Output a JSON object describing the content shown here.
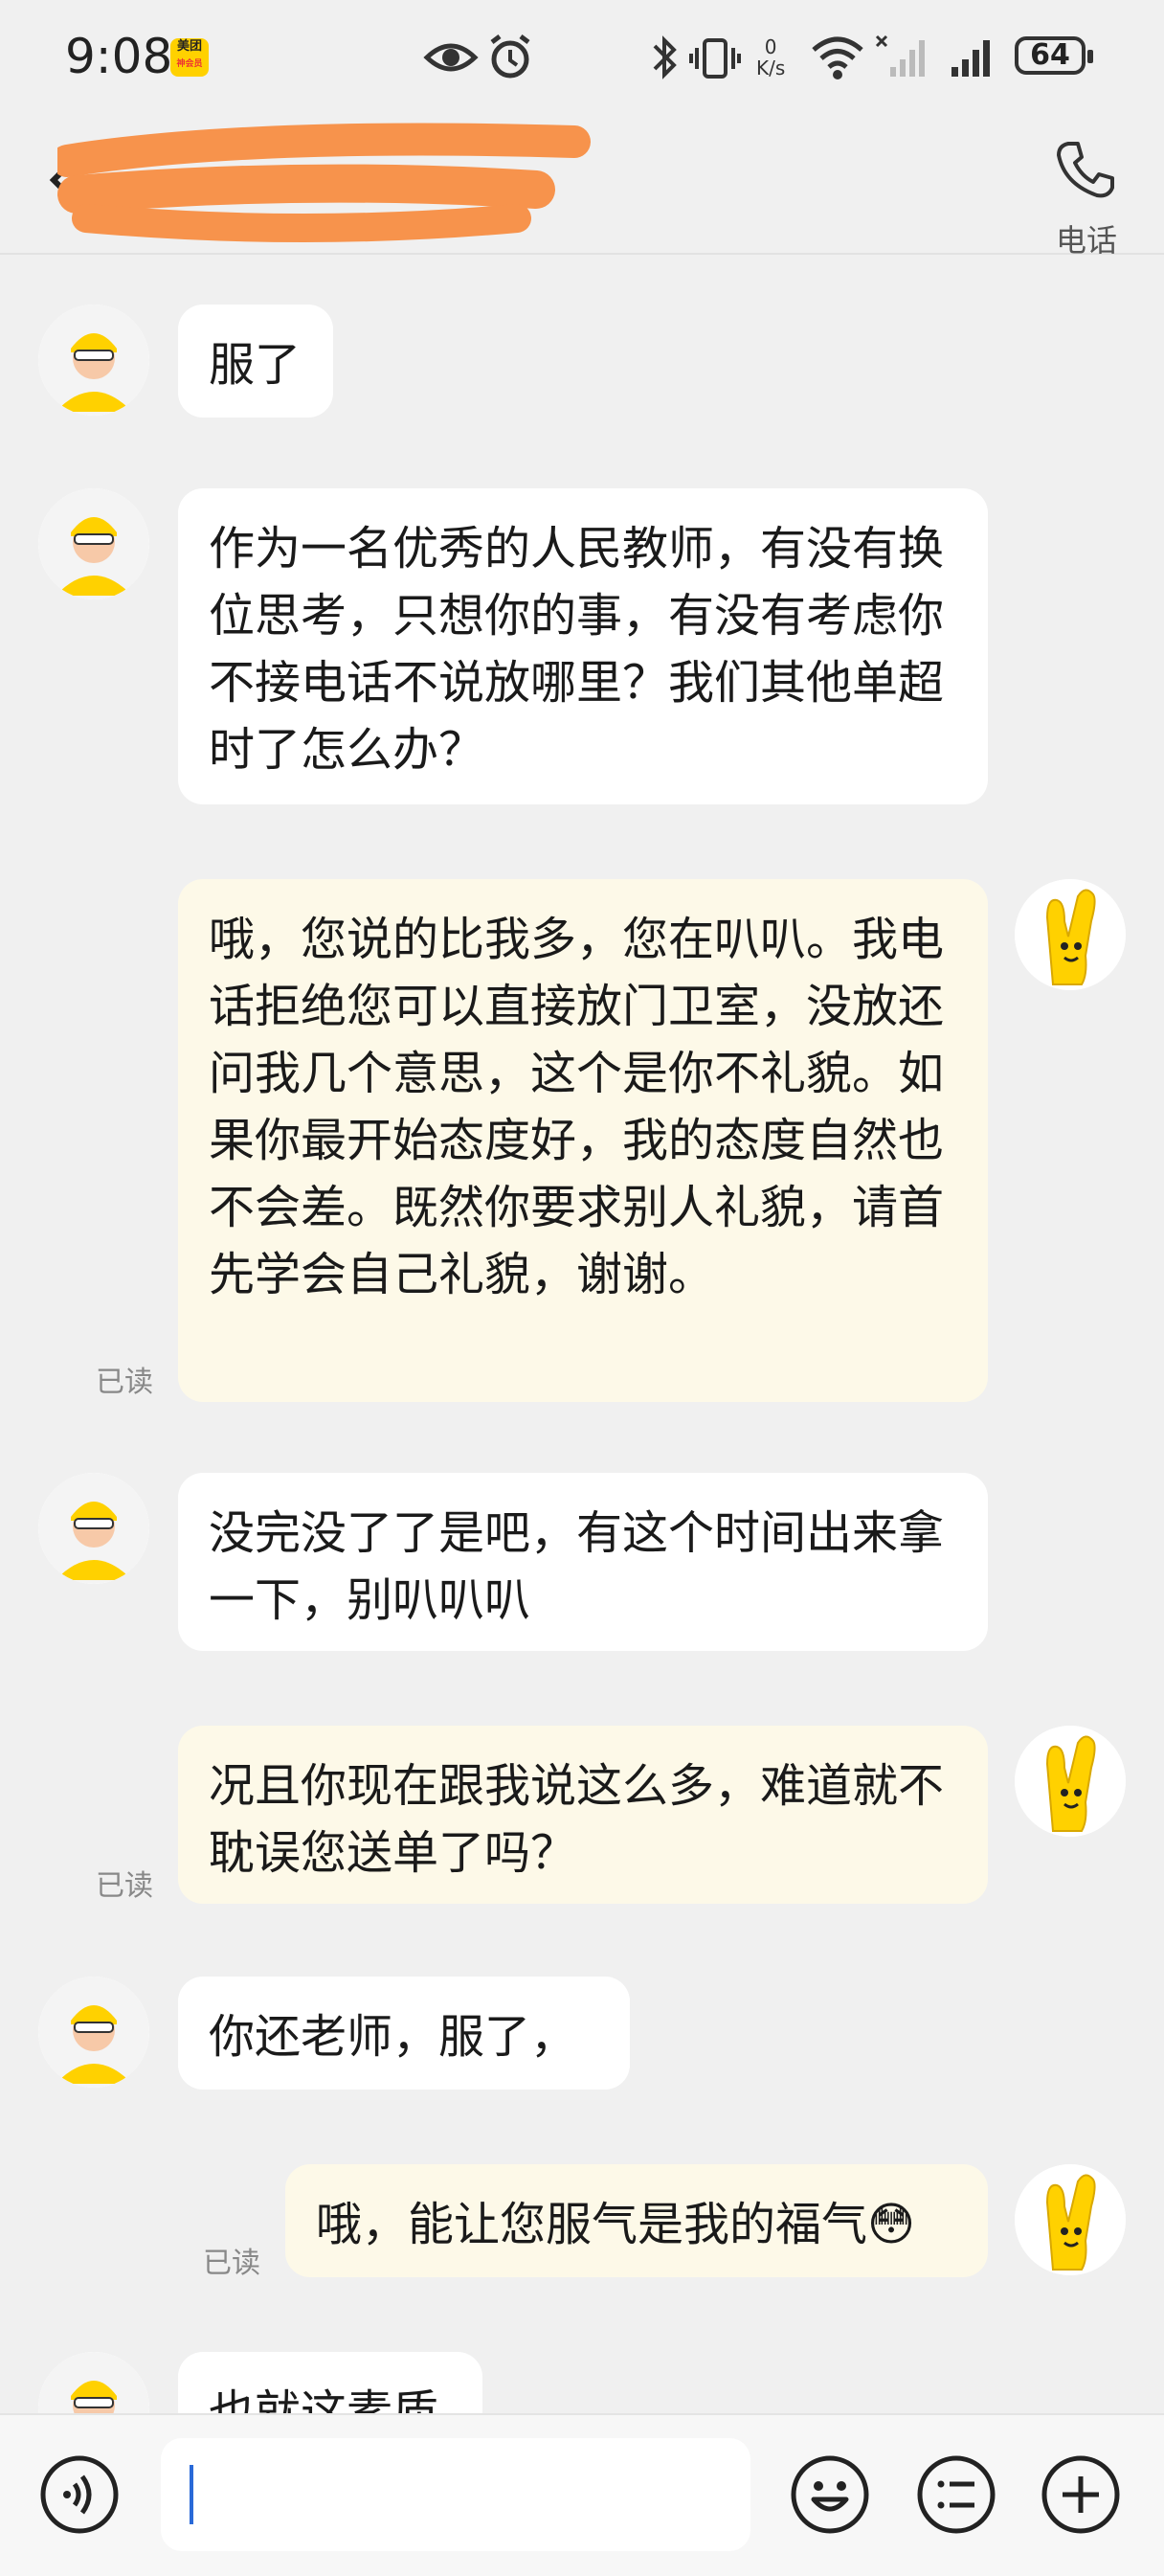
{
  "status_bar": {
    "time": "9:08",
    "app_badge_text": "美团",
    "app_badge_sub": "神会员",
    "net_speed_value": "0",
    "net_speed_unit": "K/s",
    "battery": "64"
  },
  "header": {
    "title_redacted": true,
    "phone_label": "电话"
  },
  "messages": [
    {
      "side": "in",
      "text": "服了"
    },
    {
      "side": "in",
      "text": "作为一名优秀的人民教师，有没有换位思考，只想你的事，有没有考虑你不接电话不说放哪里？我们其他单超时了怎么办？"
    },
    {
      "side": "out",
      "text": "哦，您说的比我多，您在叭叭。我电话拒绝您可以直接放门卫室，没放还问我几个意思，这个是你不礼貌。如果你最开始态度好，我的态度自然也不会差。既然你要求别人礼貌，请首先学会自己礼貌，谢谢。",
      "status": "已读"
    },
    {
      "side": "in",
      "text": "没完没了了是吧，有这个时间出来拿一下，别叭叭叭"
    },
    {
      "side": "out",
      "text": "况且你现在跟我说这么多，难道就不耽误您送单了吗？",
      "status": "已读"
    },
    {
      "side": "in",
      "text": "你还老师，服了，"
    },
    {
      "side": "out",
      "text": "哦，能让您服气是我的福气😳",
      "status": "已读"
    },
    {
      "side": "in",
      "text": "也就这素质"
    }
  ],
  "input_bar": {
    "placeholder": "",
    "voice_icon": "voice-icon",
    "emoji_icon": "emoji-icon",
    "quick_reply_icon": "list-icon",
    "more_icon": "plus-icon"
  },
  "colors": {
    "background": "#f0f0f0",
    "incoming_bubble": "#ffffff",
    "outgoing_bubble": "#fdf9e8",
    "brand_yellow": "#ffd100",
    "redaction": "#f7934c"
  }
}
